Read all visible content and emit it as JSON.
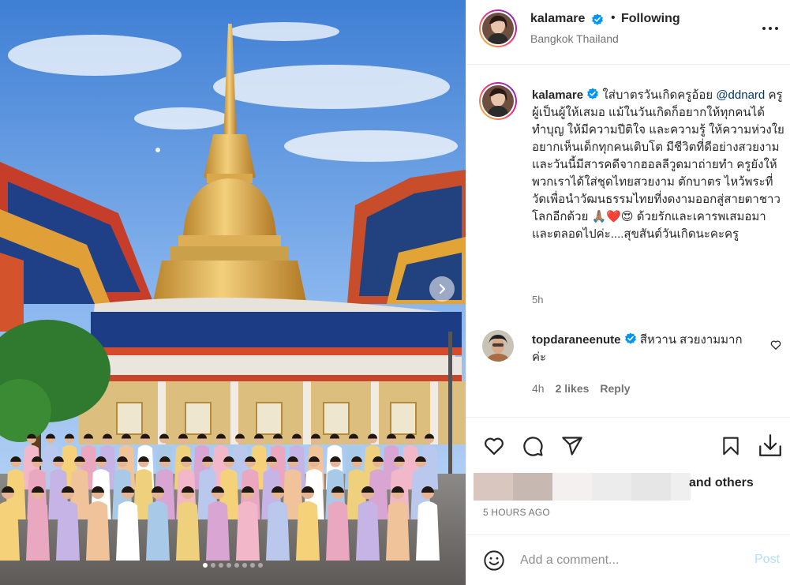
{
  "post": {
    "image_alt": "Group photo in front of a golden chedi at a Thai temple",
    "carousel": {
      "total": 8,
      "active": 1
    }
  },
  "header": {
    "username": "kalamare",
    "separator": "•",
    "follow_label": "Following",
    "location": "Bangkok Thailand"
  },
  "caption": {
    "username": "kalamare",
    "text_before_mention": "ใส่บาตรวันเกิดครูอ้อย",
    "mention": "@ddnard",
    "text_after_mention": "ครูผู้เป็นผู้ให้เสมอ แม้ในวันเกิดก็อยากให้ทุกคนได้ทำบุญ ให้มีความปีติใจ และความรู้ ให้ความห่วงใย อยากเห็นเด็กทุกคนเติบโต มีชีวิตที่ดีอย่างสวยงาม และวันนี้มีสารคดีจากฮอลลีวูดมาถ่ายทำ ครูยังให้พวกเราได้ใส่ชุดไทยสวยงาม ตักบาตร ไหว้พระที่วัดเพื่อนำวัฒนธรรมไทยที่งดงามออกสู่สายตาชาวโลกอีกด้วย 🙏🏽❤️😍 ด้วยรักและเคารพเสมอมาและตลอดไปค่ะ....สุขสันต์วันเกิดนะคะครู",
    "time": "5h"
  },
  "comment": {
    "username": "topdaraneenute",
    "text": "สีหวาน สวยงามมากค่ะ",
    "time": "4h",
    "likes": "2 likes",
    "reply_label": "Reply"
  },
  "actions": {
    "icons": [
      "heart-icon",
      "comment-icon",
      "share-icon",
      "bookmark-icon",
      "download-icon"
    ],
    "likes_suffix": "and others",
    "posted": "5 HOURS AGO"
  },
  "add_comment": {
    "placeholder": "Add a comment...",
    "post_label": "Post"
  },
  "colors": {
    "link": "#00376b",
    "verified": "#0095f6",
    "muted": "#737373",
    "post_disabled": "#b2dffc",
    "story_ring": [
      "#f9ce34",
      "#ee2a7b",
      "#6228d7"
    ]
  }
}
